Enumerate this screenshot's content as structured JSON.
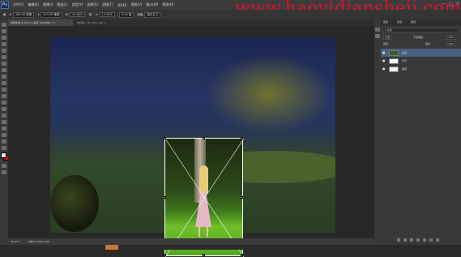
{
  "app": {
    "logo": "Ps"
  },
  "menu": {
    "items": [
      "文件(F)",
      "编辑(E)",
      "图像(I)",
      "图层(L)",
      "类型(Y)",
      "选择(S)",
      "滤镜(T)",
      "3D(D)",
      "视图(V)",
      "窗口(W)",
      "帮助(H)"
    ]
  },
  "watermark": "www.haoyidiansheji.com",
  "window_controls": {
    "minimize": "—",
    "maximize": "□",
    "close": "✕"
  },
  "options_bar": {
    "x_label": "X:",
    "x_value": "460.50 像素",
    "y_label": "Y:",
    "y_value": "319.50 像素",
    "w_label": "W:",
    "w_value": "14.85%",
    "h_label": "H:",
    "h_value": "14.33%",
    "angle_value": "0.00 度",
    "interp_label": "插值:",
    "interp_value": "两次立方"
  },
  "doc_tabs": {
    "active": "新建文档 @ 66.7% (女孩, RGB/8#) * ×",
    "inactive": "未标题-1 @ 100% (RG ×"
  },
  "status_bar": {
    "zoom": "66.67%",
    "doc_size": "文档:3.52M/5.44M"
  },
  "layers_panel": {
    "tabs": [
      "图层",
      "通道",
      "路径"
    ],
    "kind_label": "ρ 类型",
    "blend_mode": "正常",
    "opacity_label": "不透明度:",
    "opacity_value": "100%",
    "lock_label": "锁定:",
    "fill_label": "填充:",
    "fill_value": "100%",
    "layers": [
      {
        "name": "女孩",
        "selected": true
      },
      {
        "name": "背景",
        "selected": false
      },
      {
        "name": "图层",
        "selected": false
      }
    ]
  },
  "colors": {
    "foreground": "#e0e0e0",
    "background": "#c5121b",
    "watermark": "#e0102a",
    "selection": "#4a6080"
  }
}
